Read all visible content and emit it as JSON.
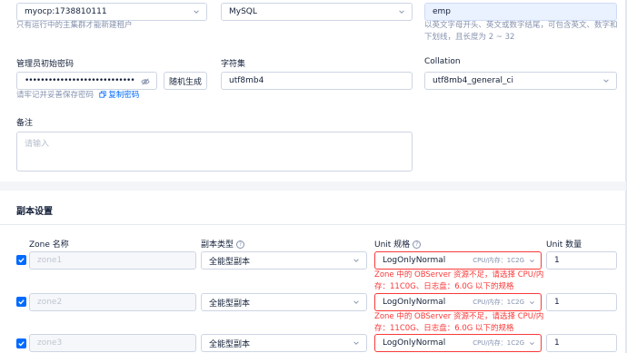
{
  "basic": {
    "cluster_value": "myocp:1738810111",
    "cluster_help": "只有运行中的主集群才能新建租户",
    "mode_value": "MySQL",
    "name_value": "emp",
    "name_help_line1": "以英文字母开头、英文或数字结尾，可包含英文、数字和",
    "name_help_line2": "下划线，且长度为 2 ~ 32",
    "password_label": "管理员初始密码",
    "password_value": "••••••••••••••••••••••••••••",
    "random_button": "随机生成",
    "password_help": "请牢记并妥善保存密码",
    "copy_link": "复制密码",
    "charset_label": "字符集",
    "charset_value": "utf8mb4",
    "collation_label": "Collation",
    "collation_value": "utf8mb4_general_ci",
    "remark_label": "备注",
    "remark_placeholder": "请输入"
  },
  "replica": {
    "section_title": "副本设置",
    "headers": {
      "zone": "Zone 名称",
      "type": "副本类型",
      "spec": "Unit 规格",
      "count": "Unit 数量"
    },
    "rows": [
      {
        "zone": "zone1",
        "type": "全能型副本",
        "spec_name": "LogOnlyNormal",
        "spec_meta": "CPU/内存：1C2G",
        "count": "1",
        "error_line1": "Zone 中的 OBServer 资源不足，请选择 CPU/内",
        "error_line2": "存：11C0G、日志盘：6.0G 以下的规格"
      },
      {
        "zone": "zone2",
        "type": "全能型副本",
        "spec_name": "LogOnlyNormal",
        "spec_meta": "CPU/内存：1C2G",
        "count": "1",
        "error_line1": "Zone 中的 OBServer 资源不足，请选择 CPU/内",
        "error_line2": "存：11C0G、日志盘：6.0G 以下的规格"
      },
      {
        "zone": "zone3",
        "type": "全能型副本",
        "spec_name": "LogOnlyNormal",
        "spec_meta": "CPU/内存：1C2G",
        "count": "1"
      }
    ]
  },
  "icons": {
    "eye_off": "eye-off-icon",
    "copy": "copy-icon",
    "chevron": "chevron-down-icon",
    "check": "check-icon",
    "help": "question-circle-icon"
  },
  "colors": {
    "primary": "#006aff",
    "error": "#f93939",
    "text": "#132039",
    "muted": "#8592ad"
  }
}
